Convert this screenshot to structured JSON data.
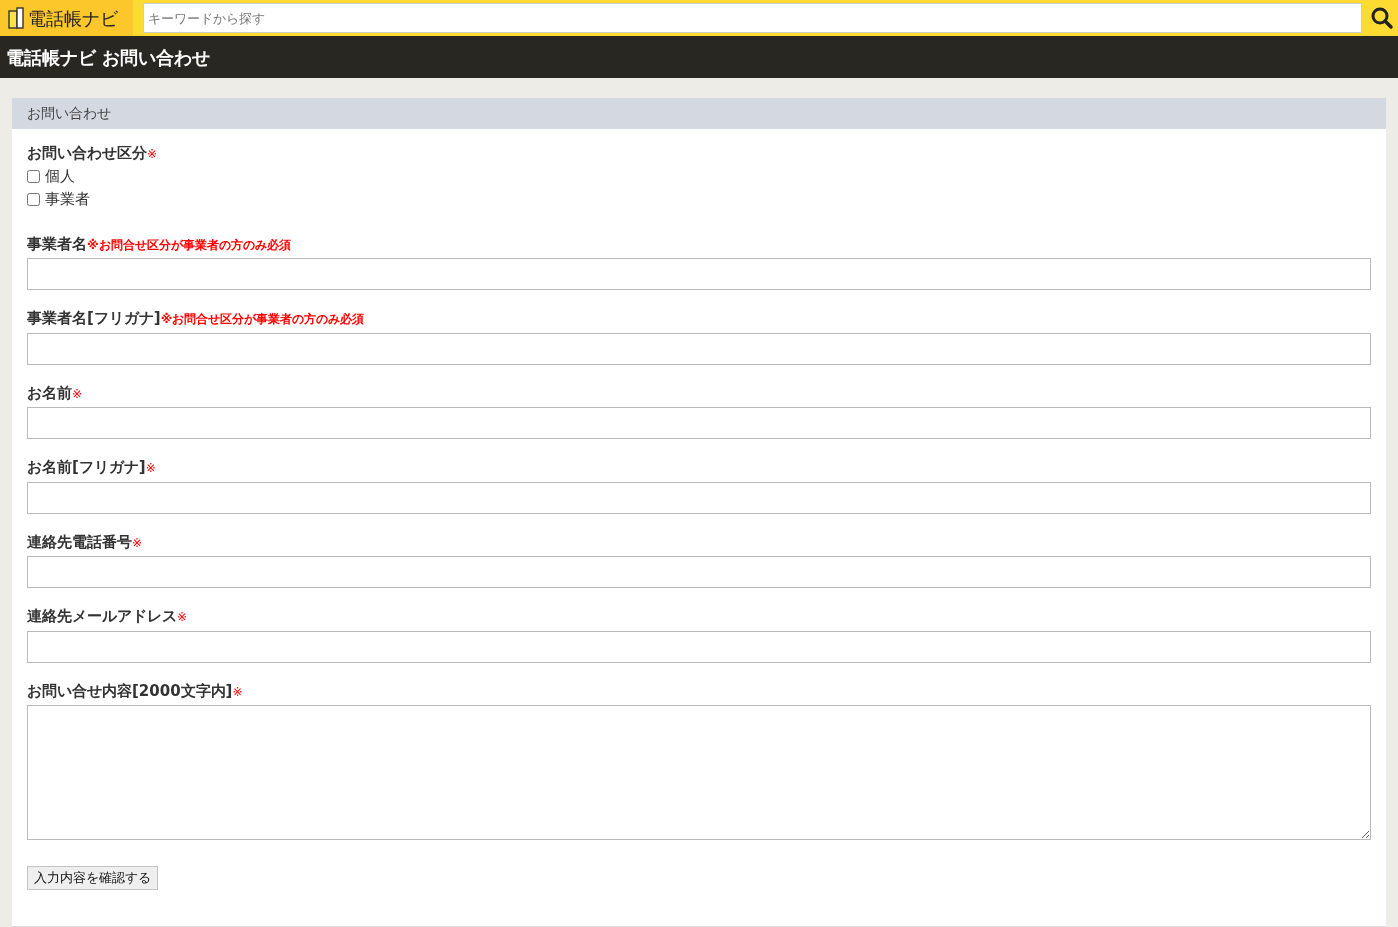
{
  "header": {
    "logo": "電話帳ナビ",
    "search": {
      "placeholder": "キーワードから探す"
    }
  },
  "title_bar": {
    "title": "電話帳ナビ お問い合わせ"
  },
  "form": {
    "heading": "お問い合わせ",
    "category": {
      "label": "お問い合わせ区分",
      "mark": {
        "kind": "asterisk",
        "text": "※"
      },
      "options": [
        {
          "label": "個人",
          "checked": false
        },
        {
          "label": "事業者",
          "checked": false
        }
      ]
    },
    "fields": [
      {
        "kind": "input",
        "label": "事業者名",
        "mark": {
          "kind": "note",
          "text": "※お問合せ区分が事業者の方のみ必須"
        }
      },
      {
        "kind": "input",
        "label": "事業者名[フリガナ]",
        "mark": {
          "kind": "note",
          "text": "※お問合せ区分が事業者の方のみ必須"
        }
      },
      {
        "kind": "input",
        "label": "お名前",
        "mark": {
          "kind": "asterisk",
          "text": "※"
        }
      },
      {
        "kind": "input",
        "label": "お名前[フリガナ]",
        "mark": {
          "kind": "asterisk",
          "text": "※"
        }
      },
      {
        "kind": "input",
        "label": "連絡先電話番号",
        "mark": {
          "kind": "asterisk",
          "text": "※"
        }
      },
      {
        "kind": "input",
        "label": "連絡先メールアドレス",
        "mark": {
          "kind": "asterisk",
          "text": "※"
        }
      },
      {
        "kind": "textarea",
        "label": "お問い合せ内容[2000文字内]",
        "mark": {
          "kind": "asterisk",
          "text": "※"
        }
      }
    ],
    "submit": "入力内容を確認する"
  }
}
